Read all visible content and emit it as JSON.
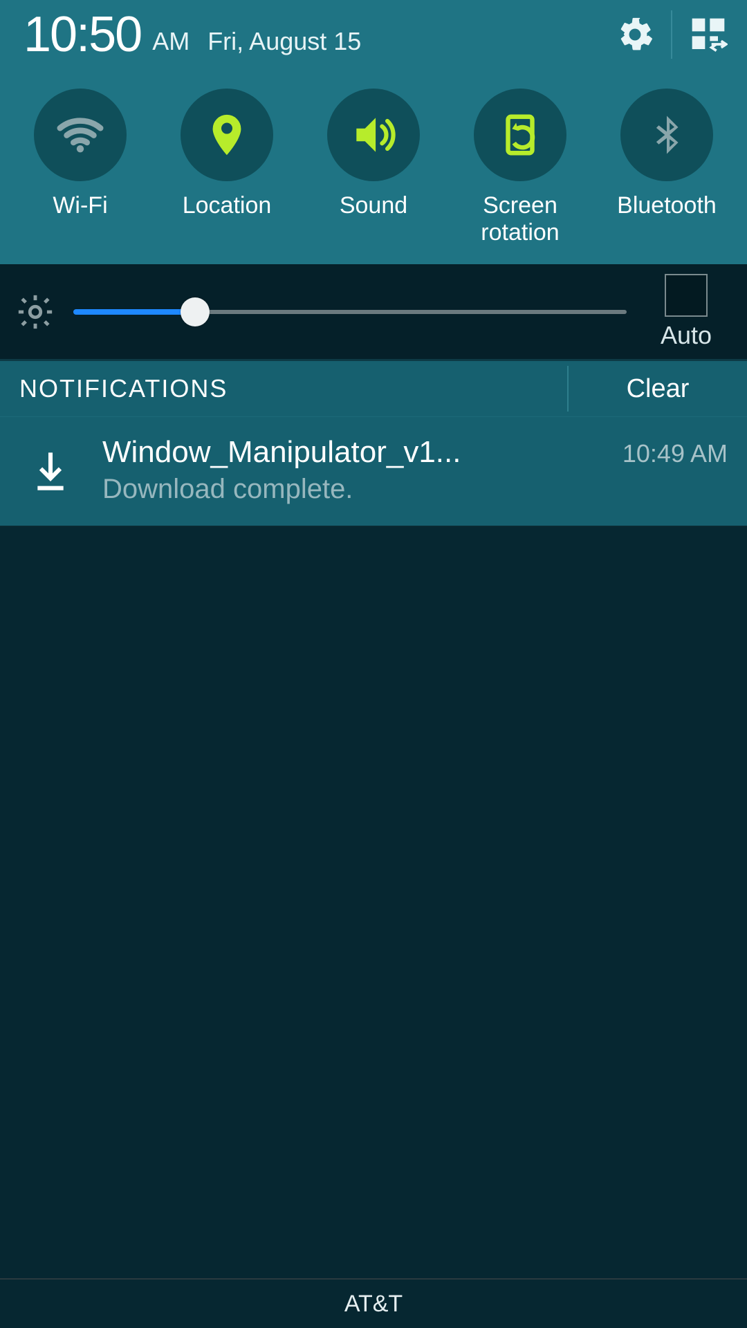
{
  "header": {
    "time": "10:50",
    "ampm": "AM",
    "date": "Fri, August 15"
  },
  "toggles": [
    {
      "label": "Wi-Fi",
      "icon": "wifi",
      "active": false
    },
    {
      "label": "Location",
      "icon": "location",
      "active": true
    },
    {
      "label": "Sound",
      "icon": "sound",
      "active": true
    },
    {
      "label": "Screen\nrotation",
      "icon": "rotation",
      "active": true
    },
    {
      "label": "Bluetooth",
      "icon": "bluetooth",
      "active": false
    }
  ],
  "brightness": {
    "percent": 22,
    "auto_label": "Auto",
    "auto_checked": false
  },
  "notifications": {
    "header": "NOTIFICATIONS",
    "clear": "Clear",
    "items": [
      {
        "title": "Window_Manipulator_v1...",
        "subtitle": "Download complete.",
        "time": "10:49 AM",
        "icon": "download"
      }
    ]
  },
  "carrier": "AT&T",
  "colors": {
    "accent_active": "#b7ec2b",
    "accent_inactive": "#8aa6ab",
    "panel_teal": "#1f7484",
    "dark_bg": "#062731"
  }
}
